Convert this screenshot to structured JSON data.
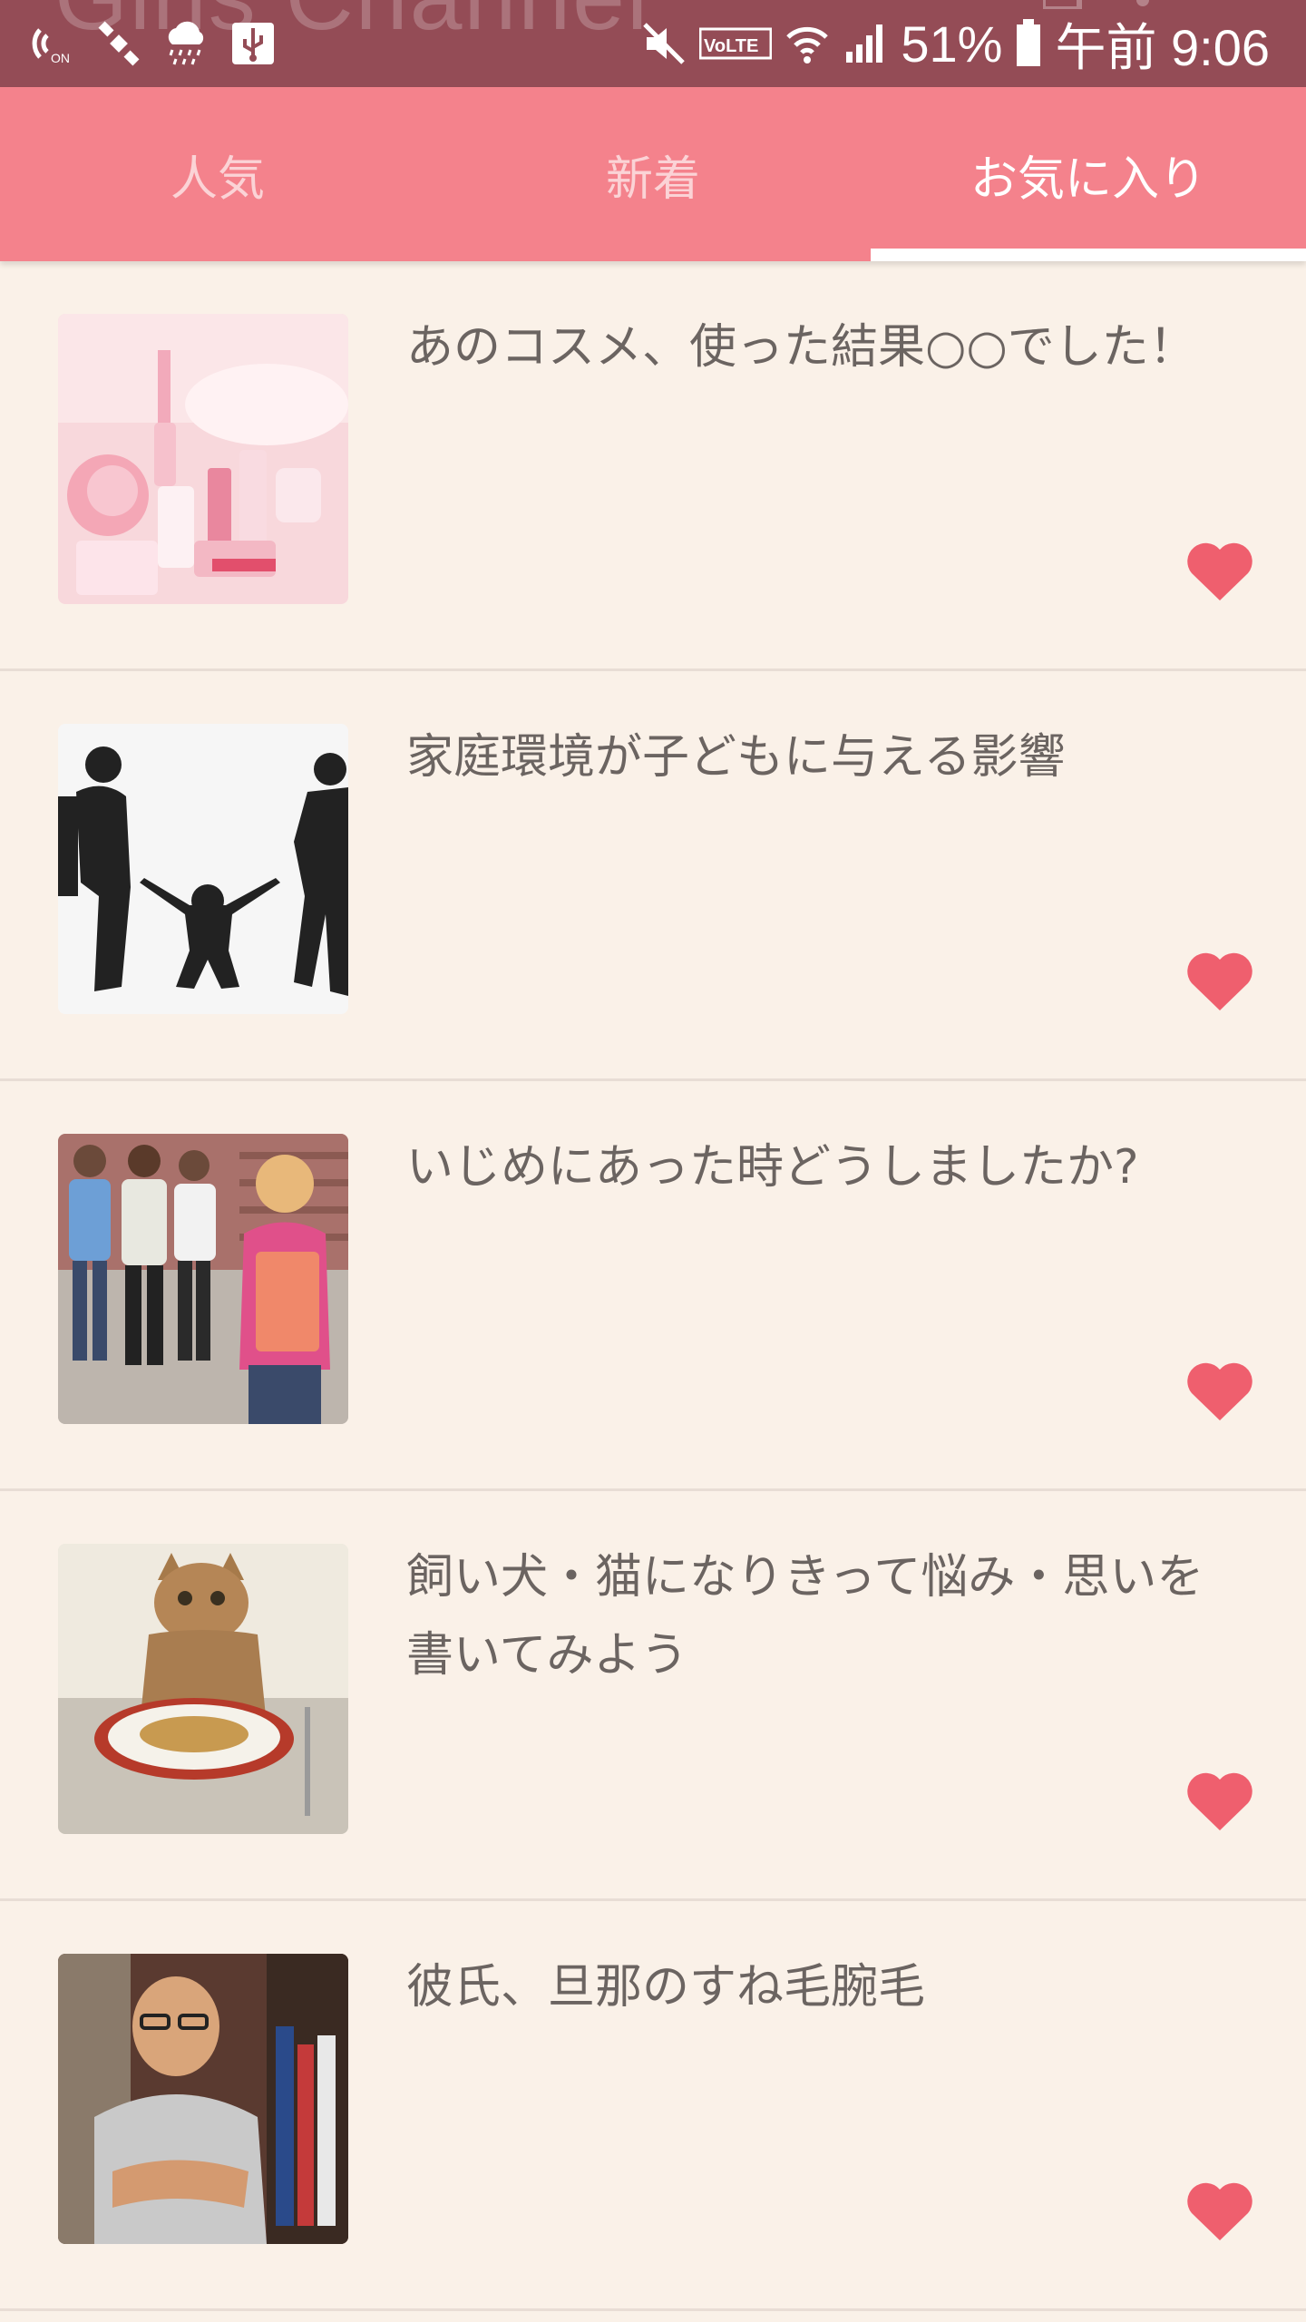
{
  "status_bar": {
    "battery": "51%",
    "time": "午前 9:06",
    "app_title_partial": "Girls Channel",
    "left_icons": [
      "nfc-icon",
      "satellite-icon",
      "rain-cloud-icon",
      "usb-icon"
    ],
    "right_icons": [
      "mute-icon",
      "volte-icon",
      "wifi-icon",
      "signal-icon",
      "battery-icon"
    ]
  },
  "tabs": [
    {
      "label": "人気",
      "active": false
    },
    {
      "label": "新着",
      "active": false
    },
    {
      "label": "お気に入り",
      "active": true
    }
  ],
  "articles": [
    {
      "title": "あのコスメ、使った結果○○でした！",
      "thumbnail": "pink-cosmetics-photo",
      "favorite": true
    },
    {
      "title": "家庭環境が子どもに与える影響",
      "thumbnail": "family-silhouette-photo",
      "favorite": true
    },
    {
      "title": "いじめにあった時どうしましたか?",
      "thumbnail": "schoolchildren-photo",
      "favorite": true
    },
    {
      "title": "飼い犬・猫になりきって悩み・思いを書いてみよう",
      "thumbnail": "cat-with-food-photo",
      "favorite": true
    },
    {
      "title": "彼氏、旦那のすね毛腕毛",
      "thumbnail": "man-arms-crossed-photo",
      "favorite": true
    }
  ],
  "colors": {
    "status_bar": "#944c56",
    "tab_bar": "#f4828c",
    "background": "#faf1e8",
    "heart": "#ef5f6e",
    "title_text": "#6b6461"
  }
}
